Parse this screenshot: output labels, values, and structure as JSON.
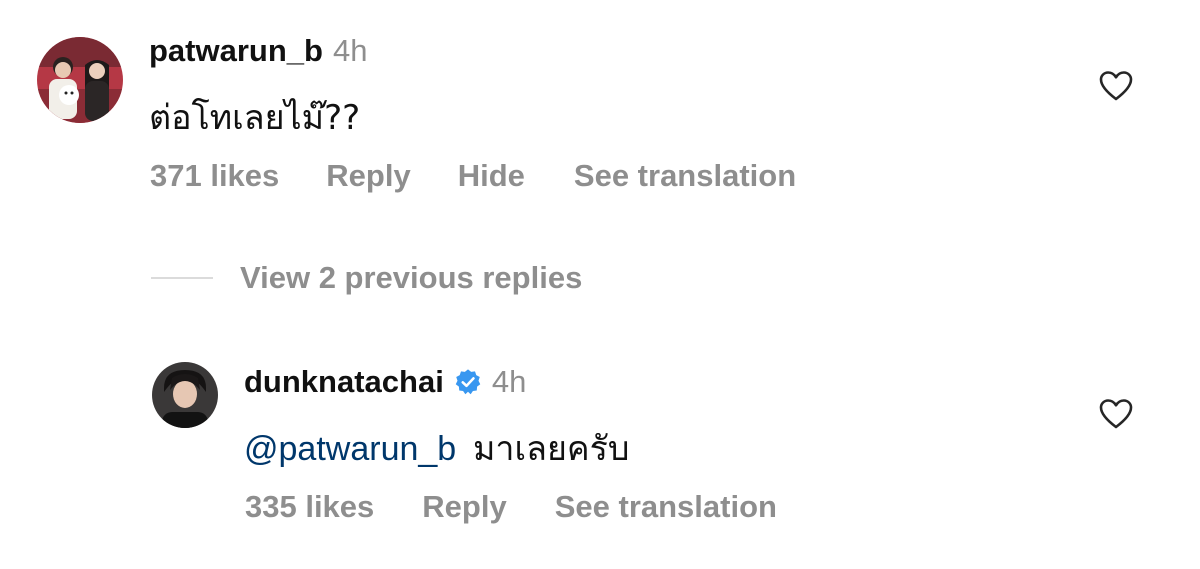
{
  "comments": [
    {
      "username": "patwarun_b",
      "time": "4h",
      "verified": false,
      "text": "ต่อโทเลยไม๊??",
      "likes": "371 likes",
      "actions": [
        "Reply",
        "Hide",
        "See translation"
      ]
    }
  ],
  "view_replies": "View 2 previous replies",
  "reply": {
    "username": "dunknatachai",
    "time": "4h",
    "verified": true,
    "mention": "@patwarun_b",
    "text": "มาเลยครับ",
    "likes": "335 likes",
    "actions": [
      "Reply",
      "See translation"
    ]
  },
  "icons": {
    "like": "heart-outline-icon",
    "verified": "verified-badge-icon"
  },
  "colors": {
    "text": "#111111",
    "muted": "#8e8e8e",
    "mention": "#00376b",
    "verified": "#3897f0"
  }
}
